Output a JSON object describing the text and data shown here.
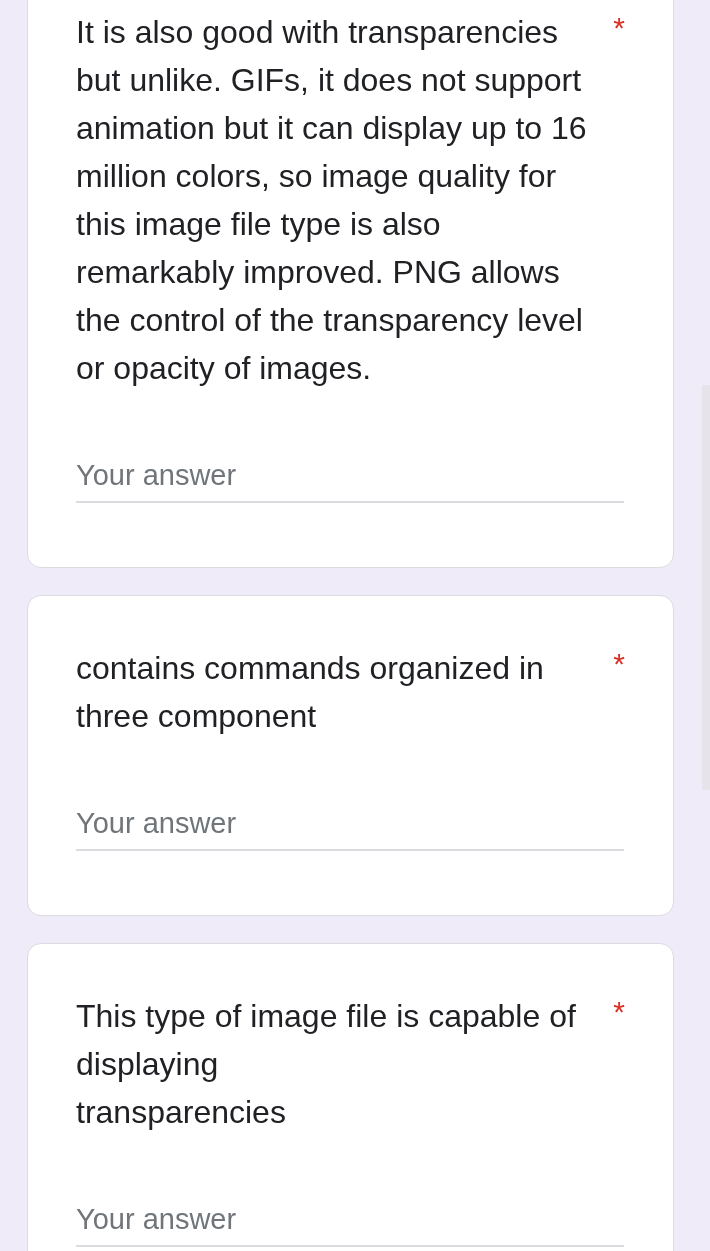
{
  "questions": [
    {
      "title": "It is also good with transparencies but unlike. GIFs, it does not support animation but it can display up to 16 million colors, so image quality for this image file type is also remarkably improved. PNG allows the control of the transparency level or opacity of images.",
      "required_mark": "*",
      "placeholder": "Your answer"
    },
    {
      "title": "contains commands organized in three component",
      "required_mark": "*",
      "placeholder": "Your answer"
    },
    {
      "title": "This type of image file is capable of displaying\ntransparencies",
      "required_mark": "*",
      "placeholder": "Your answer"
    }
  ]
}
